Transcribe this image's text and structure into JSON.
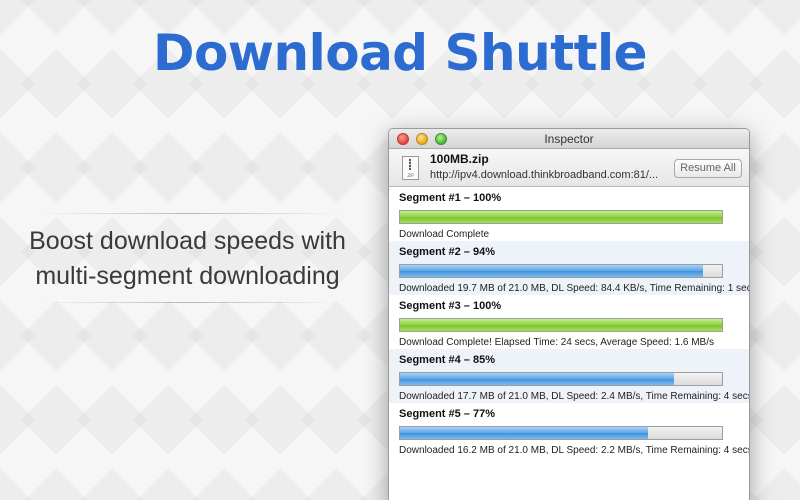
{
  "hero": {
    "title": "Download Shuttle",
    "tagline_line1": "Boost download speeds with",
    "tagline_line2": "multi-segment downloading"
  },
  "window": {
    "title": "Inspector",
    "file_name": "100MB.zip",
    "file_url": "http://ipv4.download.thinkbroadband.com:81/...",
    "resume_all_label": "Resume All",
    "segments": [
      {
        "title": "Segment #1 – 100%",
        "progress": 1.0,
        "color": "green",
        "status": "Download Complete"
      },
      {
        "title": "Segment #2 – 94%",
        "progress": 0.94,
        "color": "blue",
        "status": "Downloaded 19.7 MB of 21.0 MB, DL Speed: 84.4 KB/s, Time Remaining: 1 sec"
      },
      {
        "title": "Segment #3 – 100%",
        "progress": 1.0,
        "color": "green",
        "status": "Download Complete! Elapsed Time: 24 secs, Average Speed: 1.6 MB/s"
      },
      {
        "title": "Segment #4 – 85%",
        "progress": 0.85,
        "color": "blue",
        "status": "Downloaded 17.7 MB of 21.0 MB, DL Speed: 2.4 MB/s, Time Remaining: 4 secs"
      },
      {
        "title": "Segment #5 – 77%",
        "progress": 0.77,
        "color": "blue",
        "status": "Downloaded 16.2 MB of 21.0 MB, DL Speed: 2.2 MB/s, Time Remaining: 4 secs"
      }
    ]
  },
  "colors": {
    "hero_title": "#2c6bd0",
    "progress_complete": "#8fd142",
    "progress_active": "#4a97e0"
  }
}
